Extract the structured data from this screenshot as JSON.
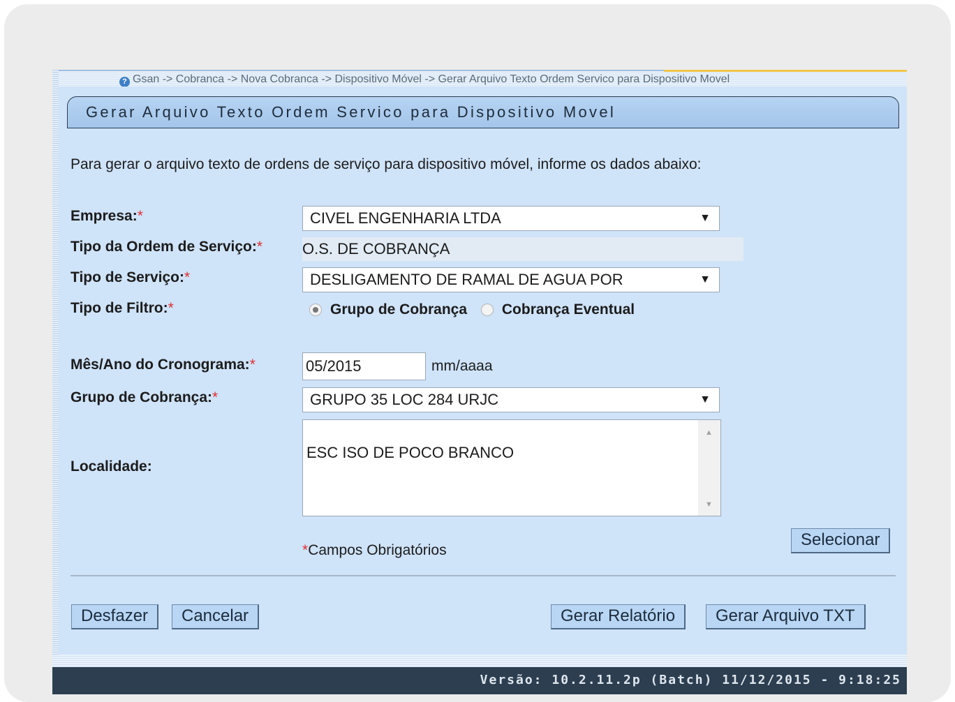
{
  "breadcrumb": "Gsan -> Cobranca -> Nova Cobranca -> Dispositivo Móvel -> Gerar Arquivo Texto Ordem Servico para Dispositivo Movel",
  "page_title": "Gerar Arquivo Texto Ordem Servico para Dispositivo Movel",
  "intro": "Para gerar o arquivo texto de ordens de serviço para dispositivo móvel, informe os dados abaixo:",
  "required_marker": "*",
  "form": {
    "empresa": {
      "label": "Empresa:",
      "value": "CIVEL ENGENHARIA LTDA"
    },
    "tipo_ordem": {
      "label": "Tipo da Ordem de Serviço:",
      "value": "O.S. DE COBRANÇA"
    },
    "tipo_servico": {
      "label": "Tipo de Serviço:",
      "value": "DESLIGAMENTO DE RAMAL DE AGUA POR"
    },
    "tipo_filtro": {
      "label": "Tipo de Filtro:",
      "options": [
        "Grupo de Cobrança",
        "Cobrança Eventual"
      ],
      "selected": "Grupo de Cobrança"
    },
    "mes_ano": {
      "label": "Mês/Ano do Cronograma:",
      "value": "05/2015",
      "hint": "mm/aaaa"
    },
    "grupo_cobranca": {
      "label": "Grupo de Cobrança:",
      "value": "GRUPO 35 LOC 284 URJC"
    },
    "localidade": {
      "label": "Localidade:",
      "items": [
        "ESC ISO DE POCO BRANCO"
      ]
    }
  },
  "buttons": {
    "selecionar": "Selecionar",
    "desfazer": "Desfazer",
    "cancelar": "Cancelar",
    "gerar_relatorio": "Gerar Relatório",
    "gerar_txt": "Gerar Arquivo TXT"
  },
  "required_note": "Campos Obrigatórios",
  "version": "Versão: 10.2.11.2p (Batch) 11/12/2015 - 9:18:25"
}
